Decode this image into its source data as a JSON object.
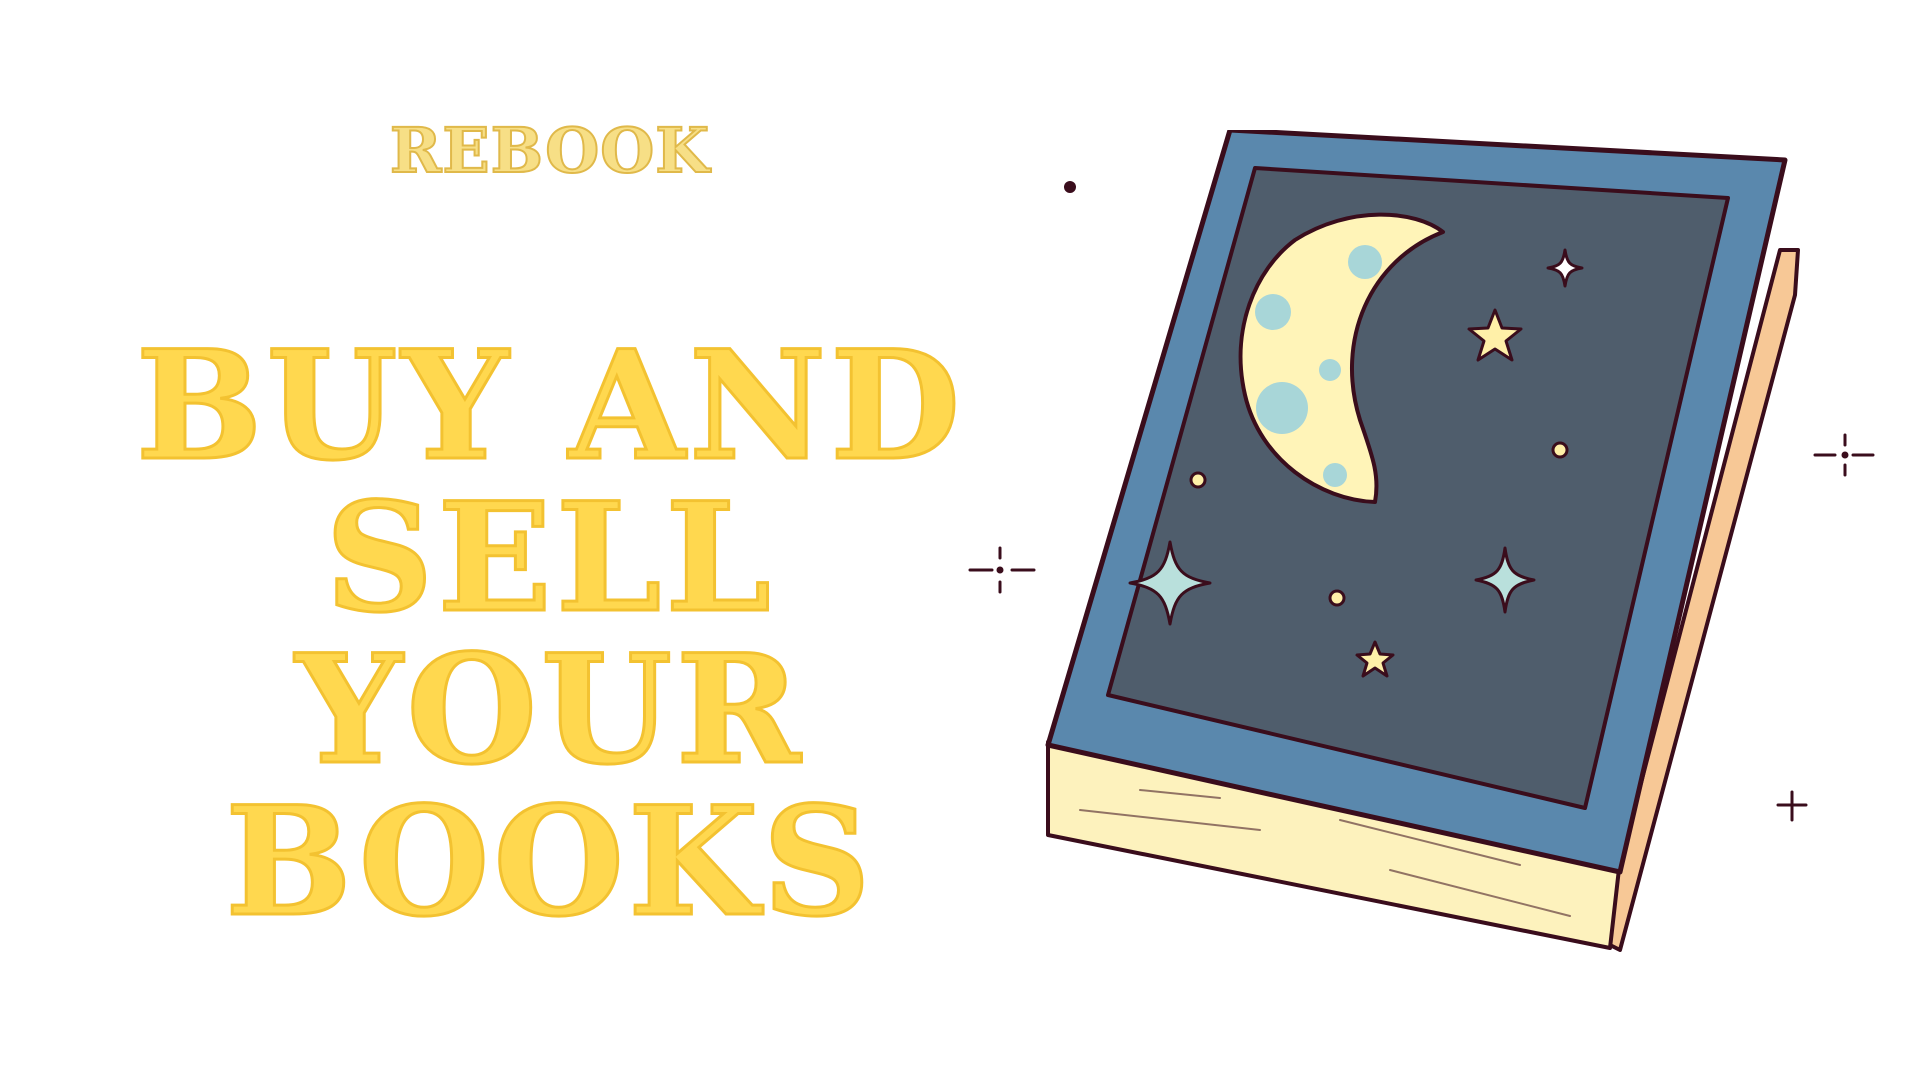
{
  "brand": {
    "name": "REBOOK"
  },
  "headline": {
    "lines": [
      "BUY AND",
      "SELL",
      "YOUR",
      "BOOKS"
    ]
  },
  "colors": {
    "headline_fill": "#ffd84f",
    "brand_fill": "#f7df86",
    "book_cover": "#5a88ad",
    "book_panel": "#4f5d6c",
    "book_pages": "#fdf2bd",
    "book_spine": "#f7c896",
    "outline": "#3a0d1c",
    "moon": "#fff4b8",
    "moon_spots": "#a8d6d8",
    "star_yellow": "#fff0a8",
    "star_teal": "#b9e0dc"
  },
  "illustration": {
    "icon": "night-book-icon"
  }
}
